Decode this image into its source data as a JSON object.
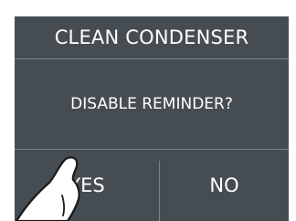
{
  "dialog": {
    "title": "CLEAN CONDENSER",
    "message": "DISABLE REMINDER?",
    "yes_label": "YES",
    "no_label": "NO"
  },
  "colors": {
    "panel_background": "#464d52",
    "text": "#ffffff",
    "divider": "#7c8388",
    "hand_fill": "#ffffff",
    "hand_outline": "#1a1a1a"
  },
  "icons": {
    "pointer": "pointing-hand-icon"
  }
}
